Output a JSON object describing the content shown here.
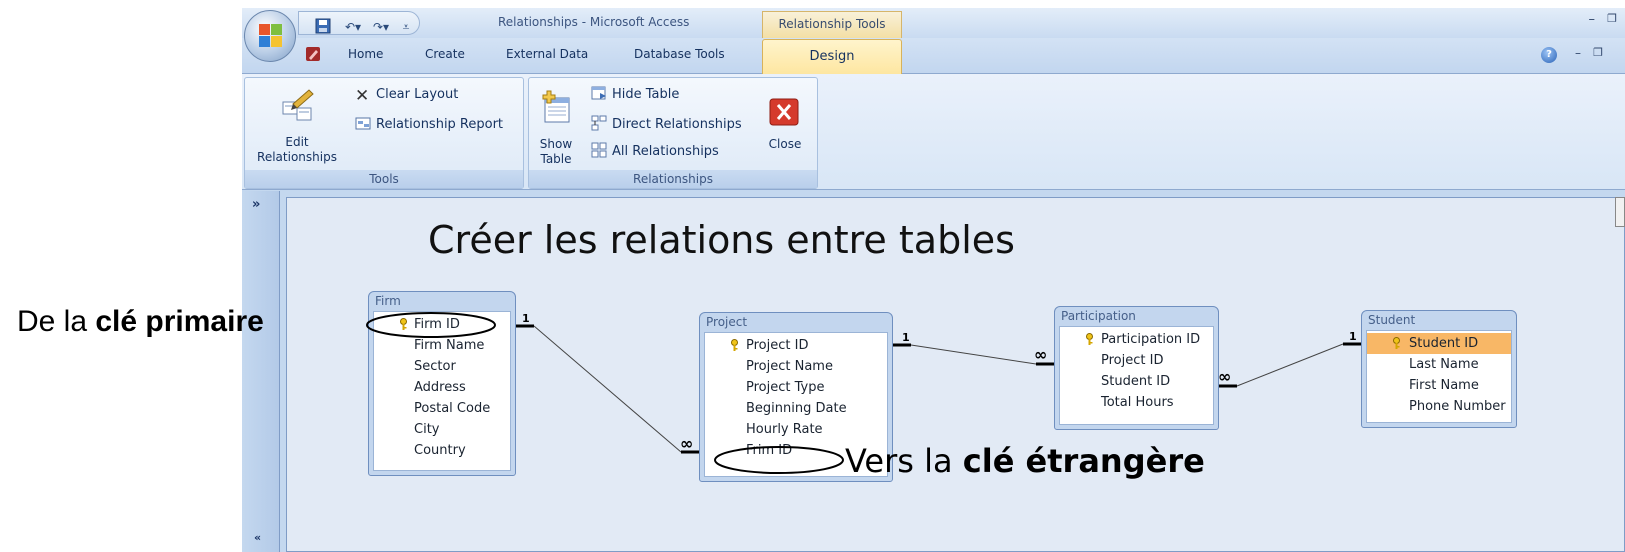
{
  "window": {
    "title": "Relationships - Microsoft Access",
    "context_tab_header": "Relationship Tools"
  },
  "tabs": {
    "home": "Home",
    "create": "Create",
    "external_data": "External Data",
    "database_tools": "Database Tools",
    "design": "Design"
  },
  "ribbon": {
    "tools_group": {
      "label": "Tools",
      "edit_relationships": "Edit\nRelationships",
      "clear_layout": "Clear Layout",
      "relationship_report": "Relationship Report"
    },
    "relationships_group": {
      "label": "Relationships",
      "show_table": "Show\nTable",
      "hide_table": "Hide Table",
      "direct_relationships": "Direct Relationships",
      "all_relationships": "All Relationships",
      "close": "Close"
    }
  },
  "nav_pane": {
    "toggle": "»",
    "label": "«"
  },
  "tables": {
    "firm": {
      "title": "Firm",
      "fields": [
        "Firm ID",
        "Firm Name",
        "Sector",
        "Address",
        "Postal Code",
        "City",
        "Country"
      ]
    },
    "project": {
      "title": "Project",
      "fields": [
        "Project ID",
        "Project Name",
        "Project Type",
        "Beginning Date",
        "Hourly Rate",
        "Frim ID"
      ]
    },
    "participation": {
      "title": "Participation",
      "fields": [
        "Participation ID",
        "Project ID",
        "Student ID",
        "Total Hours"
      ]
    },
    "student": {
      "title": "Student",
      "fields": [
        "Student ID",
        "Last Name",
        "First Name",
        "Phone Number"
      ]
    }
  },
  "relations": {
    "one": "1",
    "many": "∞"
  },
  "annotations": {
    "caption": "Créer les relations entre tables",
    "pk_prefix": "De la ",
    "pk_bold": "clé primaire",
    "fk_prefix": "Vers la ",
    "fk_bold": "clé étrangère"
  },
  "colors": {
    "ribbon_blue": "#c4d8ef",
    "context_gold": "#f3dfa5",
    "selected_field": "#f8b766",
    "workspace": "#e2eaf5"
  }
}
